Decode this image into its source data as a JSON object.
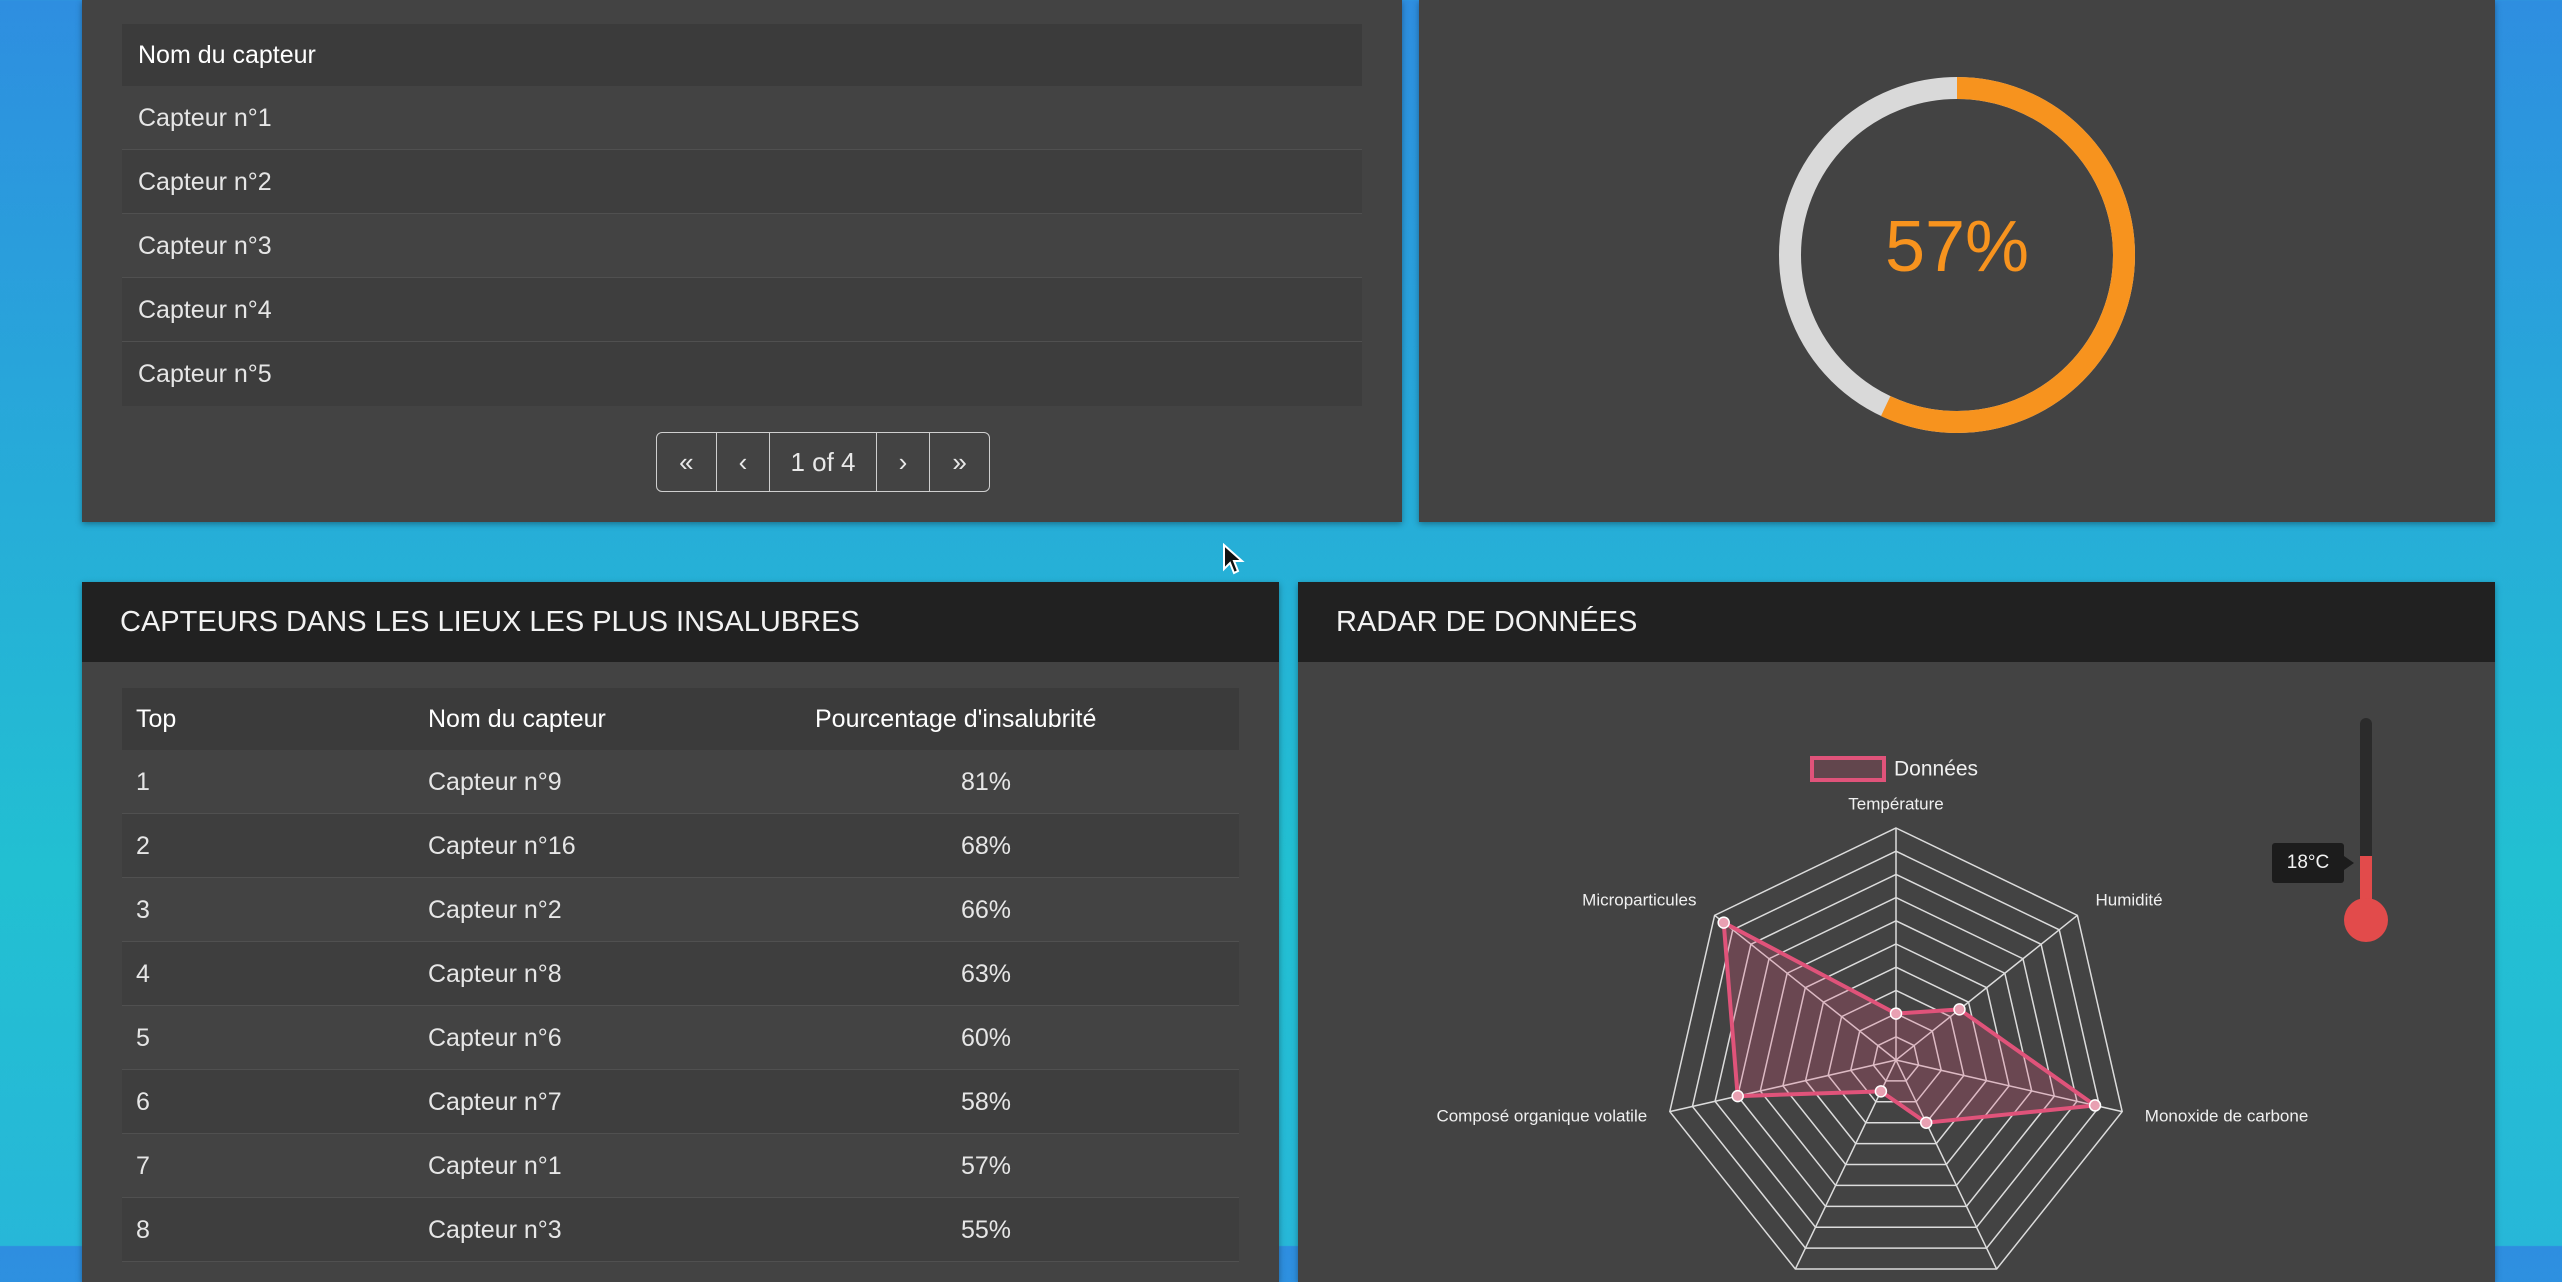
{
  "sensor_list": {
    "header": "Nom du capteur",
    "rows": [
      "Capteur n°1",
      "Capteur n°2",
      "Capteur n°3",
      "Capteur n°4",
      "Capteur n°5"
    ],
    "pagination": {
      "first": "«",
      "prev": "‹",
      "page_info": "1 of 4",
      "next": "›",
      "last": "»"
    }
  },
  "gauge": {
    "label": "57%",
    "value": 0.57,
    "color": "#f7931e",
    "track_color": "#d9d9d9"
  },
  "insalubrious": {
    "title": "CAPTEURS DANS LES LIEUX LES PLUS INSALUBRES",
    "headers": {
      "top": "Top",
      "name": "Nom du capteur",
      "pct": "Pourcentage d'insalubrité"
    },
    "rows": [
      {
        "top": "1",
        "name": "Capteur n°9",
        "pct": "81%"
      },
      {
        "top": "2",
        "name": "Capteur n°16",
        "pct": "68%"
      },
      {
        "top": "3",
        "name": "Capteur n°2",
        "pct": "66%"
      },
      {
        "top": "4",
        "name": "Capteur n°8",
        "pct": "63%"
      },
      {
        "top": "5",
        "name": "Capteur n°6",
        "pct": "60%"
      },
      {
        "top": "6",
        "name": "Capteur n°7",
        "pct": "58%"
      },
      {
        "top": "7",
        "name": "Capteur n°1",
        "pct": "57%"
      },
      {
        "top": "8",
        "name": "Capteur n°3",
        "pct": "55%"
      }
    ]
  },
  "radar": {
    "title": "RADAR DE DONNÉES",
    "thermometer": {
      "label": "18°C",
      "color": "#e24b4b"
    },
    "chart_data": {
      "type": "radar",
      "legend": "Données",
      "series_color": "#e0537a",
      "axes": [
        {
          "label": "Température",
          "value": 0.2
        },
        {
          "label": "Humidité",
          "value": 0.35
        },
        {
          "label": "Monoxide de carbone",
          "value": 0.88
        },
        {
          "label": "",
          "value": 0.3
        },
        {
          "label": "",
          "value": 0.15
        },
        {
          "label": "Composé organique volatile",
          "value": 0.7
        },
        {
          "label": "Microparticules",
          "value": 0.95
        }
      ]
    }
  }
}
